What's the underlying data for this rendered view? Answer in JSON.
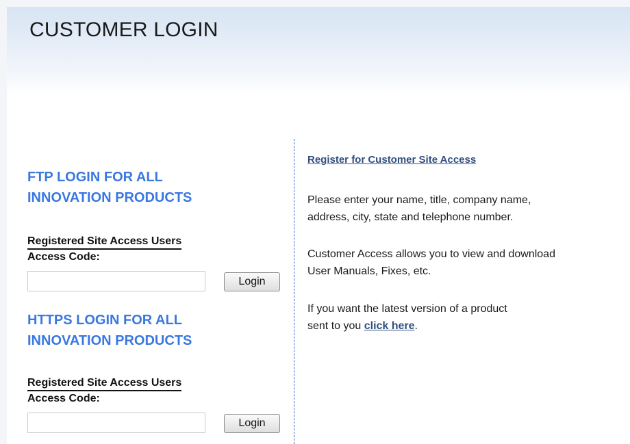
{
  "page": {
    "title": "CUSTOMER LOGIN"
  },
  "ftp": {
    "title_line1": "FTP LOGIN FOR ALL",
    "title_line2": "INNOVATION PRODUCTS",
    "users_label": "Registered Site Access Users",
    "code_label": "Access Code:",
    "code_value": "",
    "login_label": "Login"
  },
  "https": {
    "title_line1": "HTTPS LOGIN FOR ALL",
    "title_line2": "INNOVATION PRODUCTS",
    "users_label": "Registered Site Access Users",
    "code_label": "Access Code:",
    "code_value": "",
    "login_label": "Login"
  },
  "info": {
    "register_link": "Register for Customer Site Access",
    "para1_line1": "Please enter your name, title, company name,",
    "para1_line2": "address, city, state and telephone number.",
    "para2_line1": "Customer Access allows you to view and download",
    "para2_line2": "User Manuals, Fixes, etc.",
    "para3_line1": "If you want the latest version of a product",
    "para3_line2_prefix": "sent to you ",
    "para3_link": "click here",
    "para3_suffix": "."
  },
  "colors": {
    "section_title": "#3a78df",
    "link": "#2f4f7f",
    "divider": "#2a6acb",
    "header_gradient_top": "#d7e4f3"
  }
}
